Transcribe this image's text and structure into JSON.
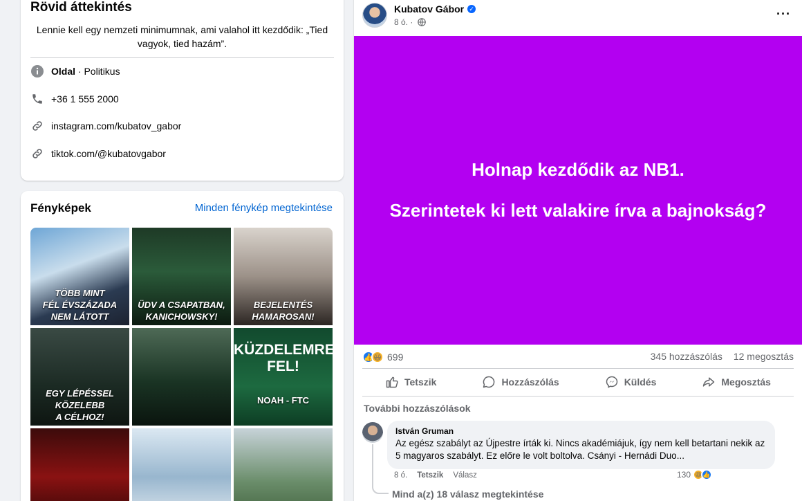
{
  "intro": {
    "title": "Rövid áttekintés",
    "bio": "Lennie kell egy nemzeti minimumnak, ami valahol itt kezdődik: „Tied vagyok, tied hazám”.",
    "category_label": "Oldal",
    "category_value": " · Politikus",
    "phone": "+36 1 555 2000",
    "instagram": "instagram.com/kubatov_gabor",
    "tiktok": "tiktok.com/@kubatovgabor"
  },
  "photos": {
    "title": "Fényképek",
    "see_all": "Minden fénykép megtekintése",
    "tiles": [
      {
        "caption": "TÖBB MINT\nFÉL ÉVSZÁZADA\nNEM LÁTOTT"
      },
      {
        "caption": "ÜDV A CSAPATBAN,\nKANICHOWSKY!"
      },
      {
        "caption": "BEJELENTÉS\nHAMAROSAN!"
      },
      {
        "caption": "EGY LÉPÉSSEL KÖZELEBB\nA CÉLHOZ!"
      },
      {
        "caption": ""
      },
      {
        "caption": "NOAH - FTC",
        "big": "KÜZDELEMRE\nFEL!"
      },
      {
        "caption": ""
      },
      {
        "caption": ""
      },
      {
        "caption": ""
      }
    ]
  },
  "post": {
    "author": "Kubatov Gábor",
    "time": "8 ó. ·",
    "banner_line1": "Holnap kezdődik az NB1.",
    "banner_line2": "Szerintetek ki lett valakire írva a bajnokság?",
    "reaction_count": "699",
    "comments_count": "345 hozzászólás",
    "shares_count": "12 megosztás",
    "actions": {
      "like": "Tetszik",
      "comment": "Hozzászólás",
      "send": "Küldés",
      "share": "Megosztás"
    },
    "more_comments": "További hozzászólások",
    "comment": {
      "author": "István Gruman",
      "text": "Az egész szabályt az Újpestre írták ki. Nincs akadémiájuk, így nem kell betartani nekik az 5 magyaros szabályt. Ez előre le volt boltolva. Csányi - Hernádi Duo...",
      "time": "8 ó.",
      "like": "Tetszik",
      "reply": "Válasz",
      "reaction_count": "130",
      "view_replies": "Mind a(z) 18 válasz megtekintése"
    }
  }
}
